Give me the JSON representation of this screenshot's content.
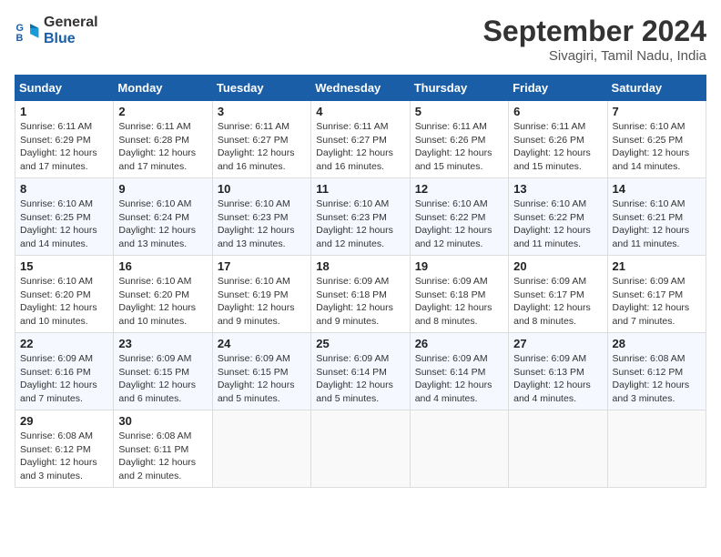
{
  "logo": {
    "line1": "General",
    "line2": "Blue"
  },
  "title": {
    "month_year": "September 2024",
    "location": "Sivagiri, Tamil Nadu, India"
  },
  "weekdays": [
    "Sunday",
    "Monday",
    "Tuesday",
    "Wednesday",
    "Thursday",
    "Friday",
    "Saturday"
  ],
  "weeks": [
    [
      {
        "day": "1",
        "sunrise": "6:11 AM",
        "sunset": "6:29 PM",
        "daylight": "12 hours and 17 minutes."
      },
      {
        "day": "2",
        "sunrise": "6:11 AM",
        "sunset": "6:28 PM",
        "daylight": "12 hours and 17 minutes."
      },
      {
        "day": "3",
        "sunrise": "6:11 AM",
        "sunset": "6:27 PM",
        "daylight": "12 hours and 16 minutes."
      },
      {
        "day": "4",
        "sunrise": "6:11 AM",
        "sunset": "6:27 PM",
        "daylight": "12 hours and 16 minutes."
      },
      {
        "day": "5",
        "sunrise": "6:11 AM",
        "sunset": "6:26 PM",
        "daylight": "12 hours and 15 minutes."
      },
      {
        "day": "6",
        "sunrise": "6:11 AM",
        "sunset": "6:26 PM",
        "daylight": "12 hours and 15 minutes."
      },
      {
        "day": "7",
        "sunrise": "6:10 AM",
        "sunset": "6:25 PM",
        "daylight": "12 hours and 14 minutes."
      }
    ],
    [
      {
        "day": "8",
        "sunrise": "6:10 AM",
        "sunset": "6:25 PM",
        "daylight": "12 hours and 14 minutes."
      },
      {
        "day": "9",
        "sunrise": "6:10 AM",
        "sunset": "6:24 PM",
        "daylight": "12 hours and 13 minutes."
      },
      {
        "day": "10",
        "sunrise": "6:10 AM",
        "sunset": "6:23 PM",
        "daylight": "12 hours and 13 minutes."
      },
      {
        "day": "11",
        "sunrise": "6:10 AM",
        "sunset": "6:23 PM",
        "daylight": "12 hours and 12 minutes."
      },
      {
        "day": "12",
        "sunrise": "6:10 AM",
        "sunset": "6:22 PM",
        "daylight": "12 hours and 12 minutes."
      },
      {
        "day": "13",
        "sunrise": "6:10 AM",
        "sunset": "6:22 PM",
        "daylight": "12 hours and 11 minutes."
      },
      {
        "day": "14",
        "sunrise": "6:10 AM",
        "sunset": "6:21 PM",
        "daylight": "12 hours and 11 minutes."
      }
    ],
    [
      {
        "day": "15",
        "sunrise": "6:10 AM",
        "sunset": "6:20 PM",
        "daylight": "12 hours and 10 minutes."
      },
      {
        "day": "16",
        "sunrise": "6:10 AM",
        "sunset": "6:20 PM",
        "daylight": "12 hours and 10 minutes."
      },
      {
        "day": "17",
        "sunrise": "6:10 AM",
        "sunset": "6:19 PM",
        "daylight": "12 hours and 9 minutes."
      },
      {
        "day": "18",
        "sunrise": "6:09 AM",
        "sunset": "6:18 PM",
        "daylight": "12 hours and 9 minutes."
      },
      {
        "day": "19",
        "sunrise": "6:09 AM",
        "sunset": "6:18 PM",
        "daylight": "12 hours and 8 minutes."
      },
      {
        "day": "20",
        "sunrise": "6:09 AM",
        "sunset": "6:17 PM",
        "daylight": "12 hours and 8 minutes."
      },
      {
        "day": "21",
        "sunrise": "6:09 AM",
        "sunset": "6:17 PM",
        "daylight": "12 hours and 7 minutes."
      }
    ],
    [
      {
        "day": "22",
        "sunrise": "6:09 AM",
        "sunset": "6:16 PM",
        "daylight": "12 hours and 7 minutes."
      },
      {
        "day": "23",
        "sunrise": "6:09 AM",
        "sunset": "6:15 PM",
        "daylight": "12 hours and 6 minutes."
      },
      {
        "day": "24",
        "sunrise": "6:09 AM",
        "sunset": "6:15 PM",
        "daylight": "12 hours and 5 minutes."
      },
      {
        "day": "25",
        "sunrise": "6:09 AM",
        "sunset": "6:14 PM",
        "daylight": "12 hours and 5 minutes."
      },
      {
        "day": "26",
        "sunrise": "6:09 AM",
        "sunset": "6:14 PM",
        "daylight": "12 hours and 4 minutes."
      },
      {
        "day": "27",
        "sunrise": "6:09 AM",
        "sunset": "6:13 PM",
        "daylight": "12 hours and 4 minutes."
      },
      {
        "day": "28",
        "sunrise": "6:08 AM",
        "sunset": "6:12 PM",
        "daylight": "12 hours and 3 minutes."
      }
    ],
    [
      {
        "day": "29",
        "sunrise": "6:08 AM",
        "sunset": "6:12 PM",
        "daylight": "12 hours and 3 minutes."
      },
      {
        "day": "30",
        "sunrise": "6:08 AM",
        "sunset": "6:11 PM",
        "daylight": "12 hours and 2 minutes."
      },
      null,
      null,
      null,
      null,
      null
    ]
  ],
  "labels": {
    "sunrise": "Sunrise:",
    "sunset": "Sunset:",
    "daylight": "Daylight:"
  }
}
